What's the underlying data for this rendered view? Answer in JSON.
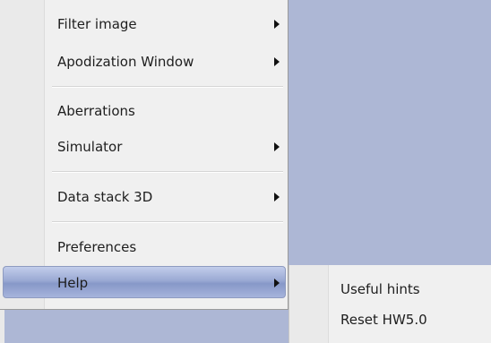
{
  "menu": {
    "items": [
      {
        "label": "Filter image",
        "has_submenu": true
      },
      {
        "label": "Apodization Window",
        "has_submenu": true
      },
      {
        "label": "Aberrations",
        "has_submenu": false
      },
      {
        "label": "Simulator",
        "has_submenu": true
      },
      {
        "label": "Data stack 3D",
        "has_submenu": true
      },
      {
        "label": "Preferences",
        "has_submenu": false
      },
      {
        "label": "Help",
        "has_submenu": true,
        "highlighted": true
      }
    ]
  },
  "submenu": {
    "items": [
      {
        "label": "Useful hints"
      },
      {
        "label": "Reset HW5.0"
      }
    ]
  },
  "colors": {
    "background": "#adb7d5",
    "menu_background": "#f0f0f0",
    "highlight": "#9aa9d3"
  }
}
